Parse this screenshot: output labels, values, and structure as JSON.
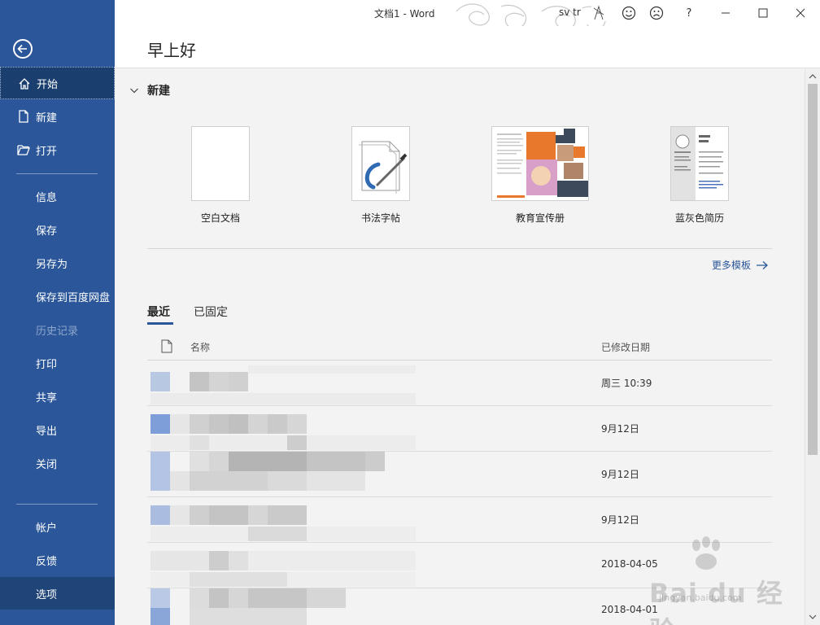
{
  "window": {
    "doc_title": "文档1  -  Word",
    "user_name": "sv tr",
    "title_buttons": [
      "smile-icon",
      "frown-icon",
      "help-icon",
      "minimize-icon",
      "maximize-icon",
      "close-icon"
    ],
    "help_label": "?"
  },
  "sidebar": {
    "items": [
      {
        "label": "开始",
        "icon": "home-icon"
      },
      {
        "label": "新建",
        "icon": "new-doc-icon"
      },
      {
        "label": "打开",
        "icon": "open-folder-icon"
      },
      {
        "label": "信息"
      },
      {
        "label": "保存"
      },
      {
        "label": "另存为"
      },
      {
        "label": "保存到百度网盘"
      },
      {
        "label": "历史记录"
      },
      {
        "label": "打印"
      },
      {
        "label": "共享"
      },
      {
        "label": "导出"
      },
      {
        "label": "关闭"
      },
      {
        "label": "帐户"
      },
      {
        "label": "反馈"
      },
      {
        "label": "选项"
      }
    ]
  },
  "greeting": "早上好",
  "new_section": {
    "title": "新建",
    "templates": [
      {
        "label": "空白文档"
      },
      {
        "label": "书法字帖"
      },
      {
        "label": "教育宣传册"
      },
      {
        "label": "蓝灰色简历"
      }
    ],
    "more_templates": "更多模板"
  },
  "tabs": {
    "recent": "最近",
    "pinned": "已固定"
  },
  "list": {
    "col_name": "名称",
    "col_date": "已修改日期",
    "rows": [
      {
        "date": "周三 10:39"
      },
      {
        "date": "9月12日"
      },
      {
        "date": "9月12日"
      },
      {
        "date": "9月12日"
      },
      {
        "date": "2018-04-05"
      },
      {
        "date": "2018-04-01"
      }
    ]
  },
  "watermark": {
    "text": "Bai du 经验",
    "url": "jingyan.baidu.com"
  },
  "colors": {
    "accent": "#2b579a",
    "sidebar_active": "#1a3e6e"
  }
}
